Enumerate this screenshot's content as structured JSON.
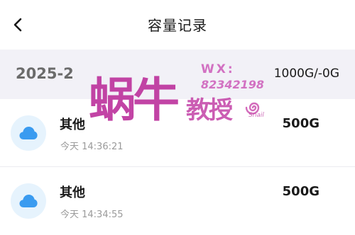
{
  "header": {
    "title": "容量记录",
    "back_icon": "chevron-left-icon"
  },
  "month_group": {
    "label": "2025-2",
    "summary": "1000G/-0G"
  },
  "records": [
    {
      "name": "其他",
      "time": "今天 14:36:21",
      "size": "500G",
      "icon": "cloud-icon"
    },
    {
      "name": "其他",
      "time": "今天 14:34:55",
      "size": "500G",
      "icon": "cloud-icon"
    }
  ],
  "watermark": {
    "big_text": "蜗牛",
    "small_text": "教授",
    "wx_label": "WX:",
    "wx_number": "82342198",
    "tail_text": "Snail"
  },
  "colors": {
    "month_bar_bg": "#f2f1f7",
    "cloud_icon": "#3a9bf0",
    "cloud_bg": "#e6f3fd",
    "watermark": "#ba2a98"
  }
}
